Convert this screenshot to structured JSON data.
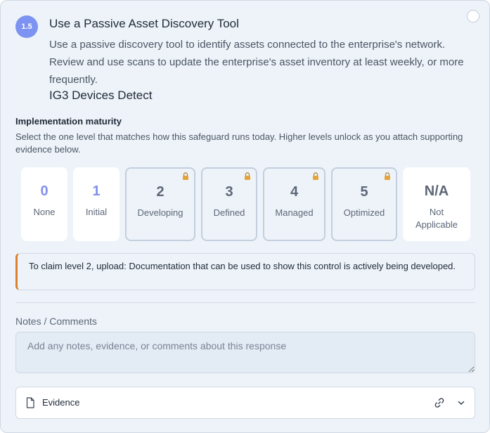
{
  "safeguard": {
    "number": "1.5",
    "title": "Use a Passive Asset Discovery Tool",
    "description": "Use a passive discovery tool to identify assets connected to the enterprise's network. Review and use scans to update the enterprise's asset inventory at least weekly, or more frequently.",
    "tags": "IG3 Devices Detect",
    "selected": false
  },
  "maturity": {
    "heading": "Implementation maturity",
    "help": "Select the one level that matches how this safeguard runs today. Higher levels unlock as you attach supporting evidence below.",
    "levels": [
      {
        "value": "0",
        "label": "None",
        "locked": false
      },
      {
        "value": "1",
        "label": "Initial",
        "locked": false
      },
      {
        "value": "2",
        "label": "Developing",
        "locked": true
      },
      {
        "value": "3",
        "label": "Defined",
        "locked": true
      },
      {
        "value": "4",
        "label": "Managed",
        "locked": true
      },
      {
        "value": "5",
        "label": "Optimized",
        "locked": true
      },
      {
        "value": "N/A",
        "label": "Not Applicable",
        "locked": false
      }
    ],
    "notice": "To claim level 2, upload: Documentation that can be used to show this control is actively being developed."
  },
  "notes": {
    "label": "Notes / Comments",
    "placeholder": "Add any notes, evidence, or comments about this response",
    "value": ""
  },
  "evidence": {
    "label": "Evidence",
    "link_icon": "link-icon",
    "expand_icon": "chevron-down-icon"
  },
  "colors": {
    "badge": "#7c93f1",
    "open_level": "#8090ee",
    "notice_accent": "#d9822b",
    "card_background": "#eef3f9"
  }
}
